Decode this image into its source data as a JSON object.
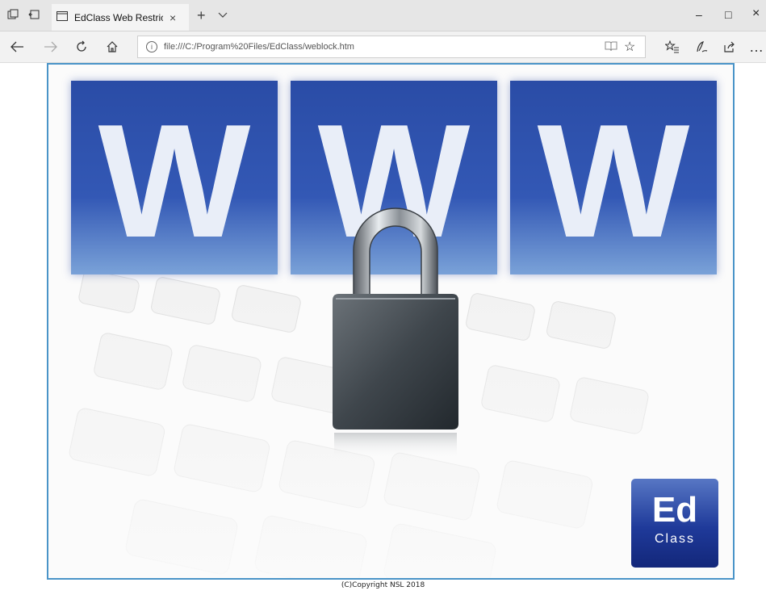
{
  "tab": {
    "title": "EdClass Web Restriction"
  },
  "address": {
    "url": "file:///C:/Program%20Files/EdClass/weblock.htm"
  },
  "page": {
    "tiles": [
      "W",
      "W",
      "W"
    ],
    "logo": {
      "big": "Ed",
      "small": "Class"
    },
    "copyright": "(C)Copyright NSL 2018"
  },
  "icons": {
    "close_tab": "×",
    "new_tab": "+",
    "minimize": "–",
    "maximize": "□",
    "close_window": "×",
    "more": "…"
  },
  "colors": {
    "frame_border": "#4a94c8",
    "tile_blue": "#3358b5",
    "logo_blue": "#1f3a9a"
  }
}
